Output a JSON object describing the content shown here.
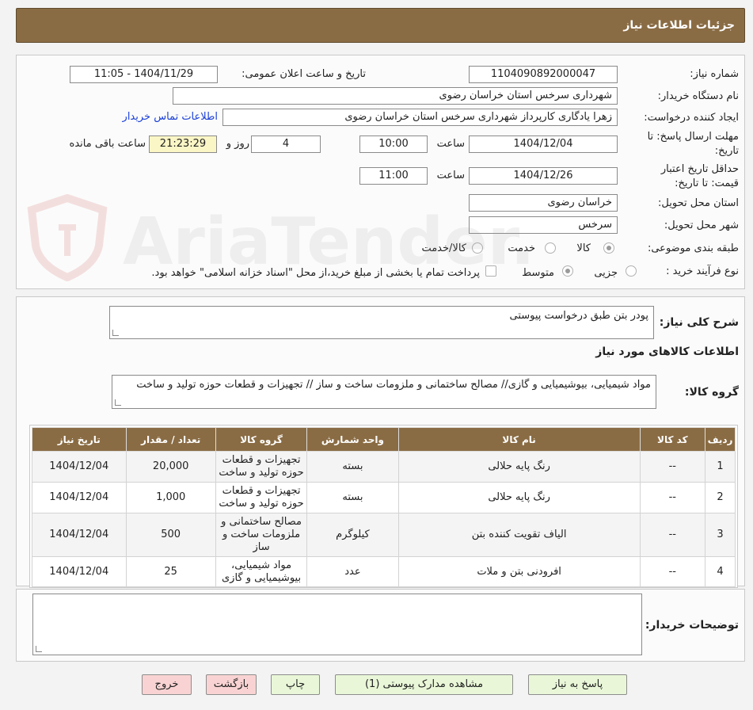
{
  "header": {
    "title": "جزئیات اطلاعات نیاز"
  },
  "form": {
    "need_number_label": "شماره نیاز:",
    "need_number": "1104090892000047",
    "announce_label": "تاریخ و ساعت اعلان عمومی:",
    "announce_value": "1404/11/29 - 11:05",
    "buyer_org_label": "نام دستگاه خریدار:",
    "buyer_org": "شهرداری سرخس استان خراسان رضوی",
    "requester_label": "ایجاد کننده درخواست:",
    "requester": "زهرا یادگاری کارپرداز شهرداری سرخس استان خراسان رضوی",
    "contact_link": "اطلاعات تماس خریدار",
    "deadline_label_1": "مهلت ارسال پاسخ: تا",
    "deadline_label_2": "تاریخ:",
    "deadline_date": "1404/12/04",
    "time_label": "ساعت",
    "deadline_time": "10:00",
    "days_value": "4",
    "days_label": "روز و",
    "remaining_time": "21:23:29",
    "remaining_label": "ساعت باقی مانده",
    "validity_label_1": "حداقل تاریخ اعتبار",
    "validity_label_2": "قیمت: تا تاریخ:",
    "validity_date": "1404/12/26",
    "validity_time": "11:00",
    "province_label": "استان محل تحویل:",
    "province": "خراسان رضوی",
    "city_label": "شهر محل تحویل:",
    "city": "سرخس",
    "category_label": "طبقه بندی موضوعی:",
    "category_options": [
      "کالا",
      "خدمت",
      "کالا/خدمت"
    ],
    "category_selected": "کالا",
    "process_label": "نوع فرآیند خرید :",
    "process_options": [
      "جزیی",
      "متوسط"
    ],
    "process_selected": "متوسط",
    "treasury_text": "پرداخت تمام یا بخشی از مبلغ خرید،از محل \"اسناد خزانه اسلامی\" خواهد بود."
  },
  "summary": {
    "label": "شرح کلی نیاز:",
    "value": "پودر بتن طبق درخواست پیوستی"
  },
  "goods": {
    "section_title": "اطلاعات کالاهای مورد نیاز",
    "group_label": "گروه کالا:",
    "group_value": "مواد شیمیایی، بیوشیمیایی و  گازی// مصالح ساختمانی و ملزومات ساخت و ساز // تجهیزات و قطعات حوزه تولید و ساخت",
    "columns": [
      "ردیف",
      "کد کالا",
      "نام کالا",
      "واحد شمارش",
      "گروه کالا",
      "تعداد / مقدار",
      "تاریخ نیاز"
    ],
    "rows": [
      {
        "idx": "1",
        "code": "--",
        "name": "رنگ پایه حلالی",
        "unit": "بسته",
        "group": "تجهیزات و قطعات حوزه تولید و ساخت",
        "qty": "20,000",
        "date": "1404/12/04"
      },
      {
        "idx": "2",
        "code": "--",
        "name": "رنگ پایه حلالی",
        "unit": "بسته",
        "group": "تجهیزات و قطعات حوزه تولید و ساخت",
        "qty": "1,000",
        "date": "1404/12/04"
      },
      {
        "idx": "3",
        "code": "--",
        "name": "الیاف تقویت کننده بتن",
        "unit": "کیلوگرم",
        "group": "مصالح ساختمانی و ملزومات ساخت و ساز",
        "qty": "500",
        "date": "1404/12/04"
      },
      {
        "idx": "4",
        "code": "--",
        "name": "افرودنی بتن و ملات",
        "unit": "عدد",
        "group": "مواد شیمیایی، بیوشیمیایی و گازی",
        "qty": "25",
        "date": "1404/12/04"
      }
    ]
  },
  "buyer_notes": {
    "label": "توضیحات خریدار:",
    "value": ""
  },
  "buttons": {
    "reply": "پاسخ به نیاز",
    "attachments": "مشاهده مدارک پیوستی (1)",
    "print": "چاپ",
    "back": "بازگشت",
    "exit": "خروج"
  },
  "watermark": {
    "text": "AriaTender.neT"
  },
  "colors": {
    "header": "#8a6c44",
    "button_green": "#e9f7d8",
    "button_pink": "#f9d3d3",
    "link": "#1a3fd8",
    "remaining_bg": "#fbf6c6"
  }
}
